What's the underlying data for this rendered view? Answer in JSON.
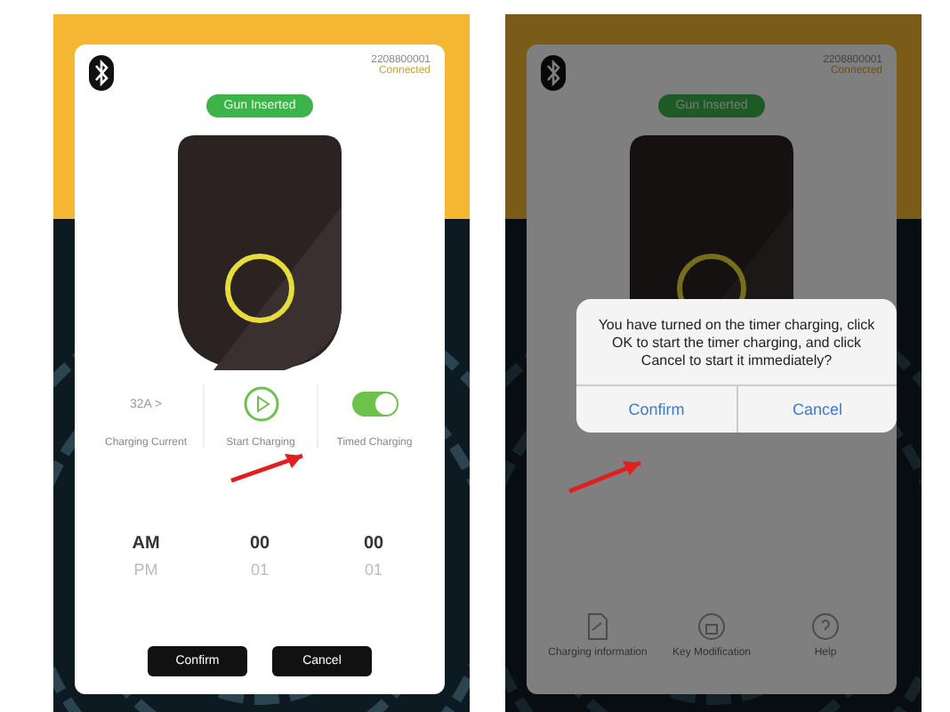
{
  "left_screen": {
    "serial": "2208800001",
    "status": "Connected",
    "badge": "Gun Inserted",
    "controls": [
      {
        "kind": "value",
        "value": "32A >",
        "label": "Charging Current"
      },
      {
        "kind": "play",
        "label": "Start Charging"
      },
      {
        "kind": "switch",
        "on": true,
        "label": "Timed Charging"
      }
    ],
    "picker": [
      [
        {
          "text": "AM",
          "selected": true
        },
        {
          "text": "PM",
          "selected": false
        }
      ],
      [
        {
          "text": "00",
          "selected": true
        },
        {
          "text": "01",
          "selected": false
        }
      ],
      [
        {
          "text": "00",
          "selected": true
        },
        {
          "text": "01",
          "selected": false
        }
      ]
    ],
    "buttons": [
      "Confirm",
      "Cancel"
    ]
  },
  "right_screen": {
    "serial": "2208800001",
    "status": "Connected",
    "badge": "Gun Inserted",
    "dialog": {
      "message": "You have turned on the timer charging, click OK to start the timer charging, and click Cancel to start it immediately?",
      "buttons": [
        "Confirm",
        "Cancel"
      ]
    },
    "menu": [
      {
        "kind": "document",
        "label": "Charging information"
      },
      {
        "kind": "key",
        "label": "Key Modification"
      },
      {
        "kind": "help",
        "label": "Help"
      }
    ]
  }
}
